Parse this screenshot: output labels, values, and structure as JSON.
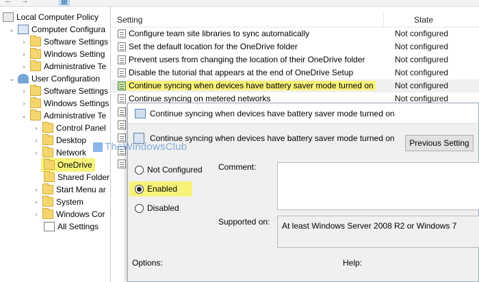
{
  "toolbar": {
    "buttons": [
      "←",
      "→",
      "▦"
    ]
  },
  "tree": {
    "items": [
      {
        "label": "Local Computer Policy"
      },
      {
        "label": "Computer Configura"
      },
      {
        "label": "Software Settings"
      },
      {
        "label": "Windows Setting"
      },
      {
        "label": "Administrative Te"
      },
      {
        "label": "User Configuration"
      },
      {
        "label": "Software Settings"
      },
      {
        "label": "Windows Settings"
      },
      {
        "label": "Administrative Te"
      },
      {
        "label": "Control Panel"
      },
      {
        "label": "Desktop"
      },
      {
        "label": "Network"
      },
      {
        "label": "OneDrive"
      },
      {
        "label": "Shared Folder"
      },
      {
        "label": "Start Menu ar"
      },
      {
        "label": "System"
      },
      {
        "label": "Windows Cor"
      },
      {
        "label": "All Settings"
      }
    ]
  },
  "list": {
    "col_setting": "Setting",
    "col_state": "State",
    "rows": [
      {
        "name": "Configure team site libraries to sync automatically",
        "state": "Not configured"
      },
      {
        "name": "Set the default location for the OneDrive folder",
        "state": "Not configured"
      },
      {
        "name": "Prevent users from changing the location of their OneDrive folder",
        "state": "Not configured"
      },
      {
        "name": "Disable the tutorial that appears at the end of OneDrive Setup",
        "state": "Not configured"
      },
      {
        "name": "Continue syncing when devices have battery saver mode turned on",
        "state": "Not configured"
      },
      {
        "name": "Continue syncing on metered networks",
        "state": "Not configured"
      }
    ]
  },
  "watermark": {
    "text": "TheWindowsClub"
  },
  "dialog": {
    "title": "Continue syncing when devices have battery saver mode turned on",
    "policy_name": "Continue syncing when devices have battery saver mode turned on",
    "prev_button": "Previous Setting",
    "radios": {
      "not_configured": "Not Configured",
      "enabled": "Enabled",
      "disabled": "Disabled",
      "selected": "Enabled"
    },
    "comment_label": "Comment:",
    "supported_label": "Supported on:",
    "supported_value": "At least Windows Server 2008 R2 or Windows 7",
    "options_label": "Options:",
    "help_label": "Help:"
  },
  "colors": {
    "highlight": "#f7f37a",
    "folder": "#f5d66e",
    "dialog_bg": "#f0f0f0"
  }
}
